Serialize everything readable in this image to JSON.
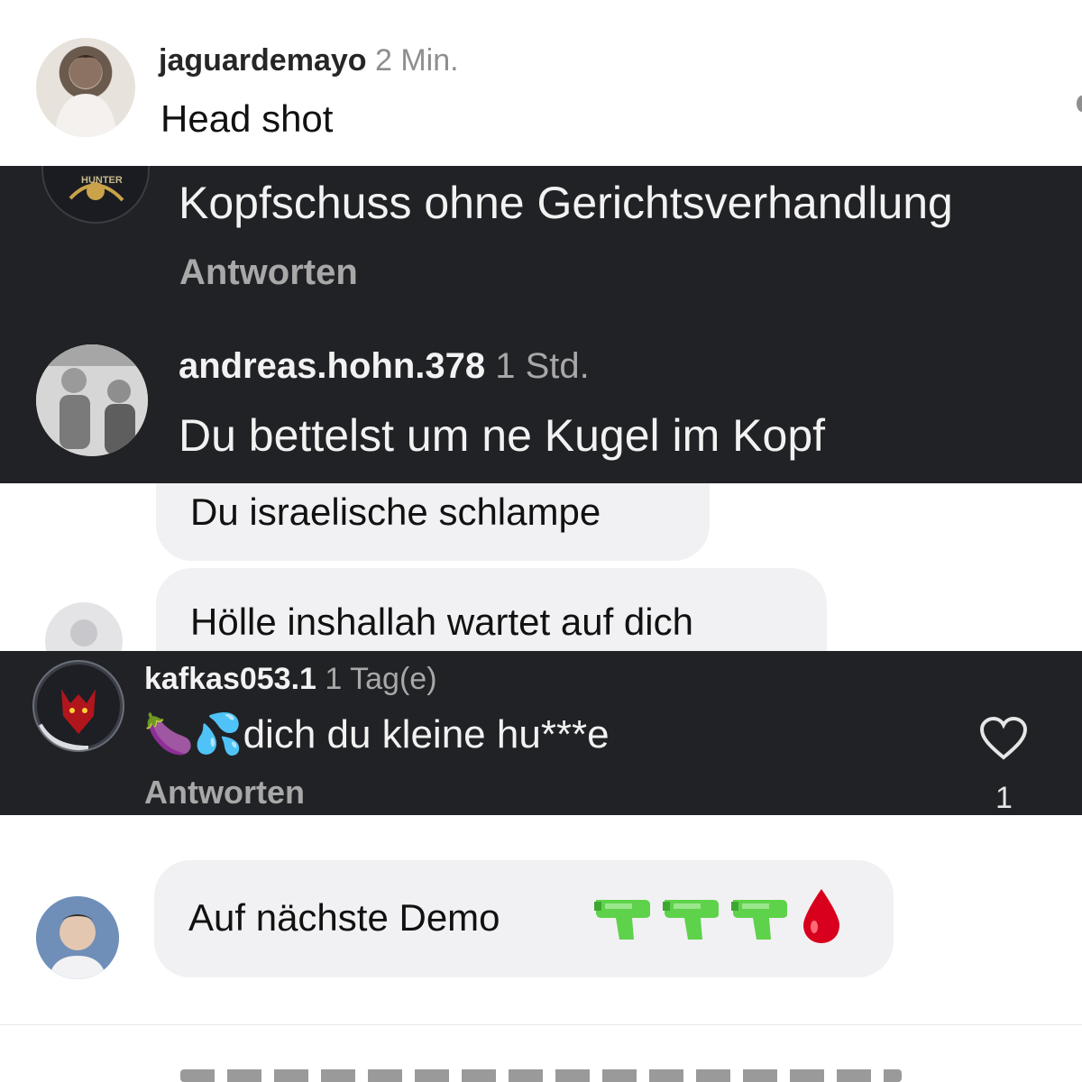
{
  "comment1": {
    "username": "jaguardemayo",
    "time": "2 Min.",
    "text": "Head shot"
  },
  "comment2": {
    "avatar_badge": "HUNTER",
    "text": "Kopfschuss ohne Gerichtsverhandlung",
    "reply_label": "Antworten"
  },
  "comment3": {
    "username": "andreas.hohn.378",
    "time": "1 Std.",
    "text": "Du bettelst um ne Kugel im Kopf"
  },
  "messages": {
    "bubble1": "Du israelische schlampe",
    "bubble2": "Hölle inshallah wartet auf dich"
  },
  "comment4": {
    "username": "kafkas053.1",
    "time": "1 Tag(e)",
    "emoji": "🍆💦",
    "text": "dich du kleine hu***e",
    "reply_label": "Antworten",
    "like_count": "1"
  },
  "message2": {
    "text": "Auf nächste Demo",
    "emoji_icons": [
      "water-pistol-icon",
      "water-pistol-icon",
      "water-pistol-icon",
      "drop-of-blood-icon"
    ]
  },
  "colors": {
    "dark_panel": "#212226",
    "bubble": "#f1f1f3",
    "water_pistol": "#5ed24a",
    "blood": "#d8001c"
  }
}
